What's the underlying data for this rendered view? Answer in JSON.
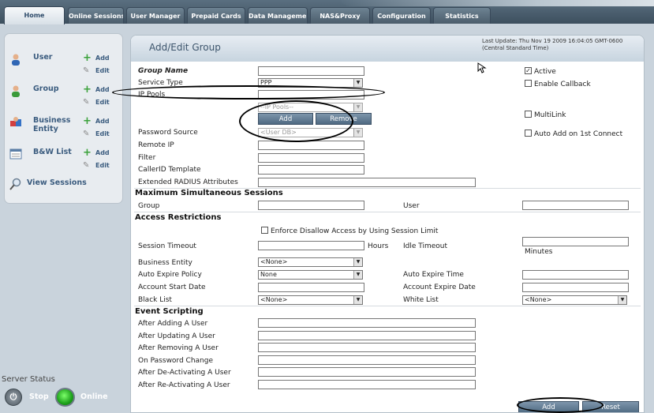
{
  "tabs": [
    {
      "label": "Home",
      "active": true
    },
    {
      "label": "Online Sessions",
      "active": false
    },
    {
      "label": "User Manager",
      "active": false
    },
    {
      "label": "Prepaid Cards",
      "active": false
    },
    {
      "label": "Data Management",
      "active": false
    },
    {
      "label": "NAS&Proxy",
      "active": false
    },
    {
      "label": "Configuration",
      "active": false
    },
    {
      "label": "Statistics",
      "active": false
    }
  ],
  "sidebar": {
    "items": [
      {
        "label": "User",
        "icon": "user-icon",
        "add": "Add",
        "edit": "Edit"
      },
      {
        "label": "Group",
        "icon": "group-icon",
        "add": "Add",
        "edit": "Edit"
      },
      {
        "label": "Business Entity",
        "icon": "business-entity-icon",
        "add": "Add",
        "edit": "Edit"
      },
      {
        "label": "B&W List",
        "icon": "list-icon",
        "add": "Add",
        "edit": "Edit"
      }
    ],
    "view_sessions": "View Sessions"
  },
  "server_status": {
    "label": "Server Status",
    "stop": "Stop",
    "online": "Online"
  },
  "panel": {
    "title": "Add/Edit Group",
    "last_update_line1": "Last Update: Thu Nov 19 2009 16:04:05 GMT-0600",
    "last_update_line2": "(Central Standard Time)"
  },
  "form": {
    "group_name_label": "Group Name",
    "service_type_label": "Service Type",
    "service_type_value": "PPP",
    "ip_pools_label": "IP Pools",
    "ip_pools_select": "--IP Pools--",
    "add_btn": "Add",
    "remove_btn": "Remove",
    "password_source_label": "Password Source",
    "password_source_value": "<User DB>",
    "remote_ip_label": "Remote IP",
    "filter_label": "Filter",
    "callerid_label": "CallerID Template",
    "ext_radius_label": "Extended RADIUS Attributes",
    "active_label": "Active",
    "active_checked": true,
    "enable_callback_label": "Enable Callback",
    "multilink_label": "MultiLink",
    "auto_add_label": "Auto Add on 1st Connect",
    "max_sessions_title": "Maximum Simultaneous Sessions",
    "group_label": "Group",
    "user_label": "User",
    "access_title": "Access Restrictions",
    "enforce_label": "Enforce Disallow Access by Using Session Limit",
    "session_timeout_label": "Session Timeout",
    "hours_label": "Hours",
    "idle_timeout_label": "Idle Timeout",
    "minutes_label": "Minutes",
    "business_entity_label": "Business Entity",
    "business_entity_value": "<None>",
    "auto_expire_policy_label": "Auto Expire Policy",
    "auto_expire_policy_value": "None",
    "auto_expire_time_label": "Auto Expire Time",
    "account_start_label": "Account Start Date",
    "account_expire_label": "Account Expire Date",
    "black_list_label": "Black List",
    "black_list_value": "<None>",
    "white_list_label": "White List",
    "white_list_value": "<None>",
    "event_title": "Event Scripting",
    "after_adding_label": "After Adding A User",
    "after_updating_label": "After Updating A User",
    "after_removing_label": "After Removing A User",
    "on_password_label": "On Password Change",
    "after_deactivating_label": "After De-Activating A User",
    "after_reactivating_label": "After Re-Activating A User",
    "submit_add": "Add",
    "reset": "Reset"
  }
}
